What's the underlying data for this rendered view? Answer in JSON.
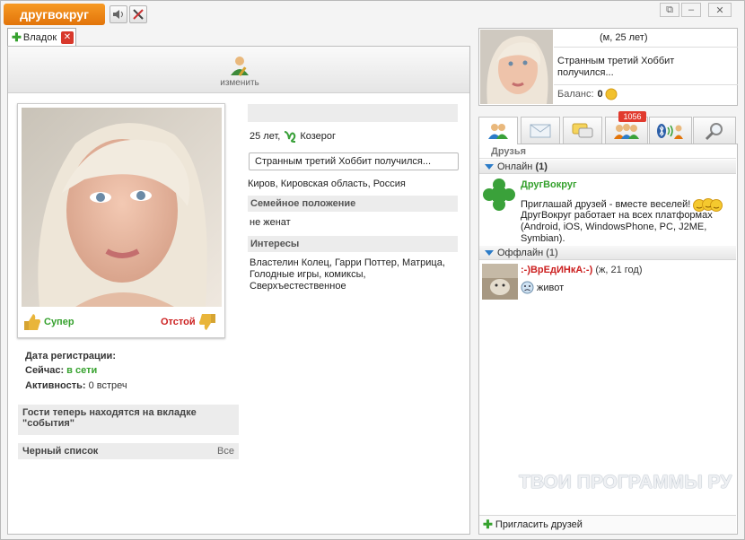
{
  "app": {
    "logo": "другвокруг"
  },
  "toolbar": {
    "sound_icon": "speaker-icon",
    "tools_icon": "tools-icon"
  },
  "window": {
    "restore": "⧉",
    "minimize": "–",
    "close": "✕"
  },
  "tab": {
    "label": "Владок",
    "plus": "✚",
    "close": "✕"
  },
  "profile": {
    "edit_label": "изменить",
    "super_label": "Супер",
    "bad_label": "Отстой",
    "age_sign": "25 лет,",
    "zodiac": "Козерог",
    "status": "Странным третий Хоббит получился...",
    "location": "Киров, Кировская область, Россия",
    "family_header": "Семейное положение",
    "family_value": "не женат",
    "interests_header": "Интересы",
    "interests_value": "Властелин Колец, Гарри Поттер, Матрица, Голодные игры, комиксы, Сверхъестественное",
    "reg_label": "Дата регистрации:",
    "now_label": "Сейчас:",
    "now_value": "в сети",
    "activity_label": "Активность:",
    "activity_value": "0 встреч",
    "guests_notice": "Гости теперь находятся на вкладке \"события\"",
    "blacklist_label": "Черный список",
    "blacklist_link": "Все"
  },
  "me": {
    "age": "(м, 25 лет)",
    "status": "Странным третий Хоббит получился...",
    "balance_label": "Баланс:",
    "balance_value": "0"
  },
  "friends": {
    "badge_count": "1056",
    "section_title": "Друзья",
    "online_label": "Онлайн",
    "online_count": "(1)",
    "offline_label": "Оффлайн",
    "offline_count": "(1)",
    "bot_name": "ДругВокруг",
    "bot_message": "Приглашай друзей - вместе веселей!",
    "bot_message2": "ДругВокруг работает на всех платформах (Android, iOS, WindowsPhone, PC, J2ME, Symbian).",
    "friend_name": ":-)ВрЕдИНкА:-)",
    "friend_info": "(ж, 21 год)",
    "friend_status": "живот",
    "invite_label": "Пригласить друзей"
  },
  "watermark": "ТВОИ ПРОГРАММЫ РУ",
  "colors": {
    "brand": "#ee8513",
    "accent_green": "#35a12d",
    "accent_red": "#cc2020",
    "link_blue": "#2c7cc8"
  }
}
